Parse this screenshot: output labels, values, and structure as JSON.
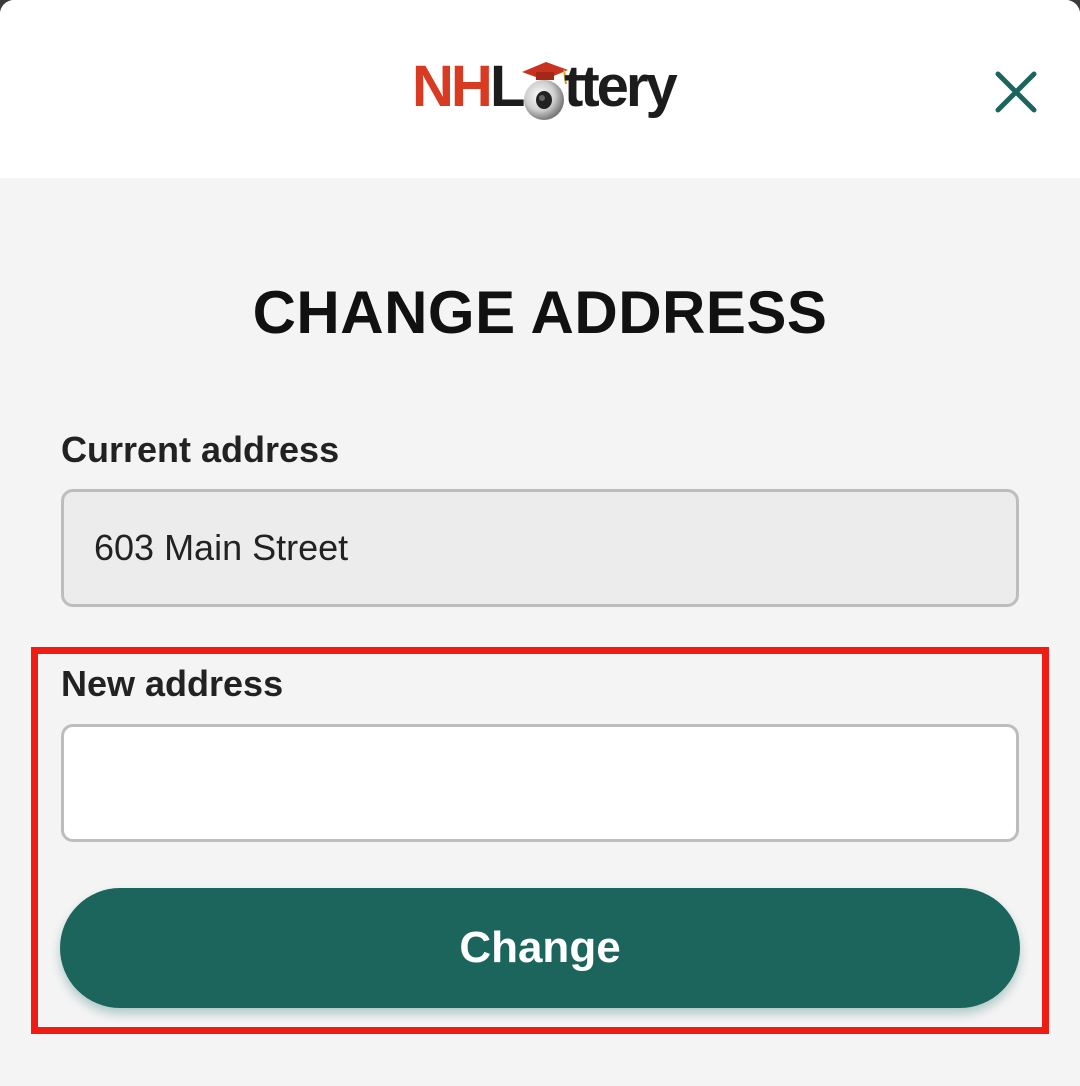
{
  "header": {
    "logo": {
      "part1": "NH",
      "part2": "L",
      "part3": "ttery",
      "alt": "NHLottery"
    },
    "close_icon": "close-icon"
  },
  "page": {
    "title": "CHANGE ADDRESS"
  },
  "form": {
    "current_label": "Current address",
    "current_value": "603 Main Street",
    "new_label": "New address",
    "new_value": "",
    "submit_label": "Change"
  },
  "colors": {
    "accent": "#1c655c",
    "logo_red": "#d83a22",
    "highlight": "#ee1c12",
    "background": "#f4f4f4"
  }
}
